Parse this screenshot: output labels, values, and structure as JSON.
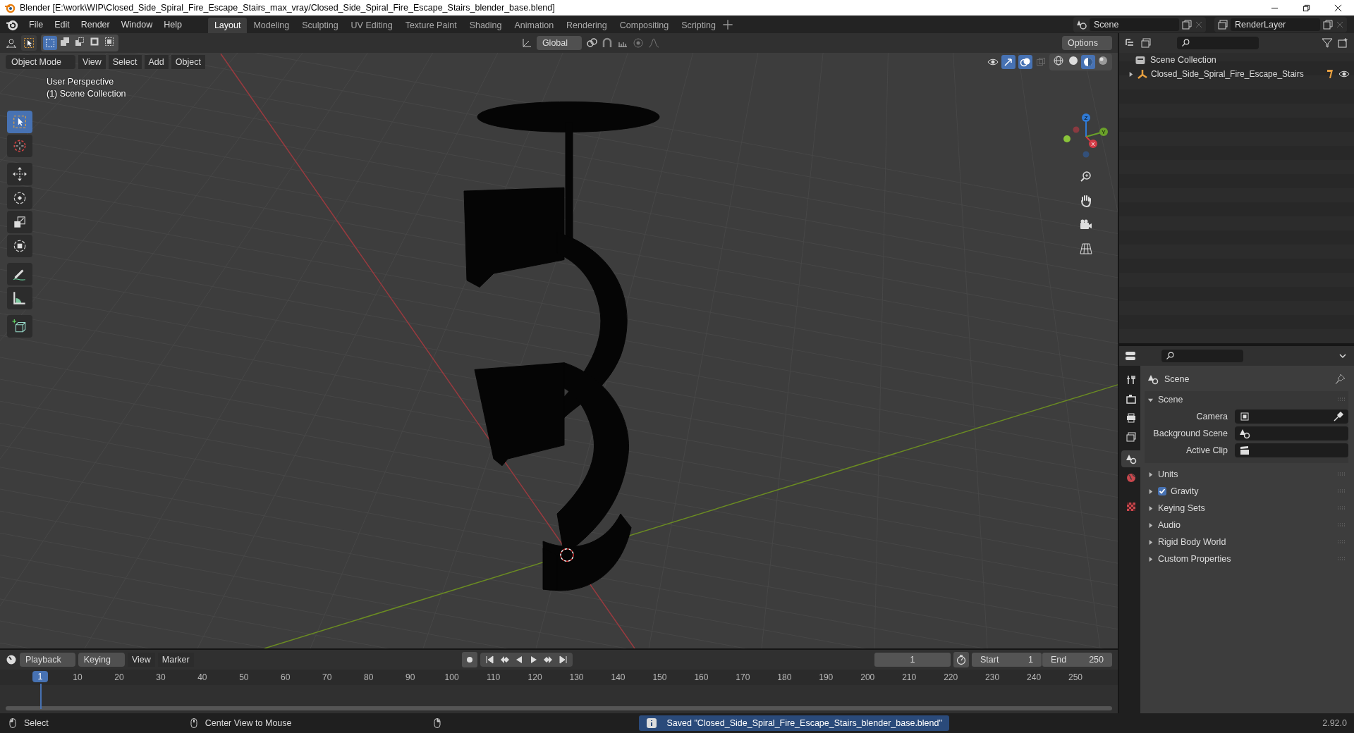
{
  "window": {
    "title": "Blender [E:\\work\\WIP\\Closed_Side_Spiral_Fire_Escape_Stairs_max_vray/Closed_Side_Spiral_Fire_Escape_Stairs_blender_base.blend]"
  },
  "menu": [
    "File",
    "Edit",
    "Render",
    "Window",
    "Help"
  ],
  "workspaces": [
    {
      "label": "Layout",
      "selected": true
    },
    {
      "label": "Modeling",
      "selected": false
    },
    {
      "label": "Sculpting",
      "selected": false
    },
    {
      "label": "UV Editing",
      "selected": false
    },
    {
      "label": "Texture Paint",
      "selected": false
    },
    {
      "label": "Shading",
      "selected": false
    },
    {
      "label": "Animation",
      "selected": false
    },
    {
      "label": "Rendering",
      "selected": false
    },
    {
      "label": "Compositing",
      "selected": false
    },
    {
      "label": "Scripting",
      "selected": false
    }
  ],
  "scene_selector": {
    "value": "Scene"
  },
  "view_layer_selector": {
    "value": "RenderLayer"
  },
  "viewport": {
    "transform_orientation": "Global",
    "options": "Options",
    "mode": "Object Mode",
    "menus": [
      "View",
      "Select",
      "Add",
      "Object"
    ],
    "overlay_text": [
      "User Perspective",
      "(1) Scene Collection"
    ],
    "tools": [
      {
        "kind": "select",
        "selected": true
      },
      {
        "kind": "cursor",
        "selected": false
      },
      {
        "kind": "move",
        "selected": false
      },
      {
        "kind": "rotate",
        "selected": false
      },
      {
        "kind": "scale",
        "selected": false
      },
      {
        "kind": "transform",
        "selected": false
      },
      {
        "kind": "annotate",
        "selected": false
      },
      {
        "kind": "measure",
        "selected": false
      },
      {
        "kind": "add_cube",
        "selected": false
      }
    ],
    "gizmo_axes": [
      "Z",
      "Y",
      "X"
    ]
  },
  "outliner": {
    "root": "Scene Collection",
    "items": [
      {
        "label": "Closed_Side_Spiral_Fire_Escape_Stairs",
        "expanded": false
      }
    ]
  },
  "properties": {
    "tabs": [
      {
        "kind": "tool",
        "selected": false
      },
      {
        "kind": "render",
        "selected": false
      },
      {
        "kind": "output",
        "selected": false
      },
      {
        "kind": "view_layer",
        "selected": false
      },
      {
        "kind": "scene",
        "selected": true
      },
      {
        "kind": "world",
        "selected": false
      },
      {
        "kind": "texture",
        "selected": false
      }
    ],
    "context": "Scene",
    "panels": [
      {
        "title": "Scene",
        "kind": "plain",
        "expanded": true,
        "fields": [
          {
            "label": "Camera",
            "kind": "camera"
          },
          {
            "label": "Background Scene",
            "kind": "scene"
          },
          {
            "label": "Active Clip",
            "kind": "clip"
          }
        ]
      },
      {
        "title": "Units",
        "kind": "plain",
        "expanded": false
      },
      {
        "title": "Gravity",
        "kind": "checkbox",
        "checked": true,
        "expanded": false
      },
      {
        "title": "Keying Sets",
        "kind": "plain",
        "expanded": false
      },
      {
        "title": "Audio",
        "kind": "plain",
        "expanded": false
      },
      {
        "title": "Rigid Body World",
        "kind": "plain",
        "expanded": false
      },
      {
        "title": "Custom Properties",
        "kind": "plain",
        "expanded": false
      }
    ]
  },
  "timeline": {
    "menus": [
      "Playback",
      "Keying",
      "View",
      "Marker"
    ],
    "current_frame": "1",
    "start_label": "Start",
    "start": "1",
    "end_label": "End",
    "end": "250",
    "playhead": "1",
    "ruler": [
      "10",
      "20",
      "30",
      "40",
      "50",
      "60",
      "70",
      "80",
      "90",
      "100",
      "110",
      "120",
      "130",
      "140",
      "150",
      "160",
      "170",
      "180",
      "190",
      "200",
      "210",
      "220",
      "230",
      "240",
      "250"
    ]
  },
  "status_bar": {
    "hints": [
      "Select",
      "Center View to Mouse"
    ],
    "message": "Saved \"Closed_Side_Spiral_Fire_Escape_Stairs_blender_base.blend\"",
    "version": "2.92.0"
  }
}
